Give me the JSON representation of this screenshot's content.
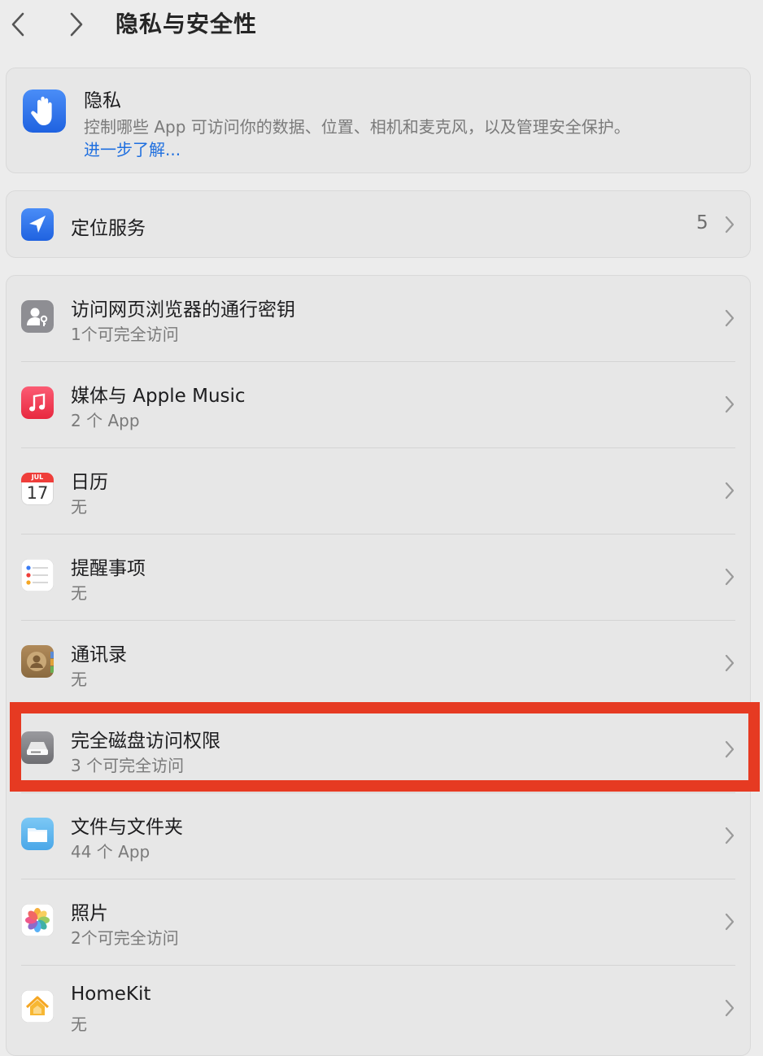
{
  "window": {
    "title": "隐私与安全性"
  },
  "privacy": {
    "title": "隐私",
    "description": "控制哪些 App 可访问你的数据、位置、相机和麦克风，以及管理安全保护。",
    "link": "进一步了解..."
  },
  "location": {
    "title": "定位服务",
    "count": "5"
  },
  "calendar_icon": {
    "month": "JUL",
    "day": "17"
  },
  "items": [
    {
      "title": "访问网页浏览器的通行密钥",
      "subtitle": "1个可完全访问",
      "icon": "passkey-icon"
    },
    {
      "title": "媒体与 Apple Music",
      "subtitle": "2 个 App",
      "icon": "music-icon"
    },
    {
      "title": "日历",
      "subtitle": "无",
      "icon": "calendar-icon"
    },
    {
      "title": "提醒事项",
      "subtitle": "无",
      "icon": "reminders-icon"
    },
    {
      "title": "通讯录",
      "subtitle": "无",
      "icon": "contacts-icon"
    },
    {
      "title": "完全磁盘访问权限",
      "subtitle": "3 个可完全访问",
      "icon": "disk-icon"
    },
    {
      "title": "文件与文件夹",
      "subtitle": "44 个 App",
      "icon": "folder-icon"
    },
    {
      "title": "照片",
      "subtitle": "2个可完全访问",
      "icon": "photos-icon"
    },
    {
      "title": "HomeKit",
      "subtitle": "无",
      "icon": "homekit-icon"
    }
  ],
  "colors": {
    "accent_link": "#1f6fdf",
    "highlight": "#e63a22",
    "background": "#ececec"
  }
}
